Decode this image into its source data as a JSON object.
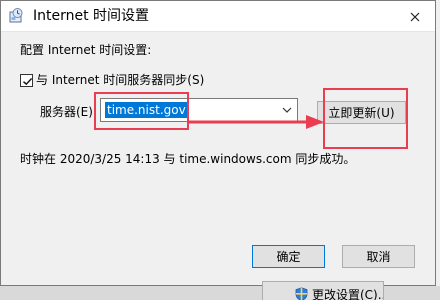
{
  "window": {
    "title": "Internet 时间设置"
  },
  "content": {
    "section_label": "配置 Internet 时间设置:",
    "sync_label": "与 Internet 时间服务器同步(S)",
    "server_label": "服务器(E):",
    "server_value": "time.nist.gov",
    "update_button": "立即更新(U)",
    "status_text": "时钟在 2020/3/25 14:13 与 time.windows.com 同步成功。"
  },
  "buttons": {
    "ok": "确定",
    "cancel": "取消"
  },
  "background": {
    "change_settings": "更改设置(C)..."
  },
  "icons": {
    "app_icon": "globe-clock-icon",
    "close_icon": "close-icon",
    "check_icon": "check-icon",
    "dropdown_icon": "chevron-down-icon",
    "shield_icon": "shield-icon"
  },
  "colors": {
    "selection": "#0078d7",
    "annotation": "#ea3d52",
    "background": "#f0f0f0",
    "button": "#e1e1e1"
  }
}
